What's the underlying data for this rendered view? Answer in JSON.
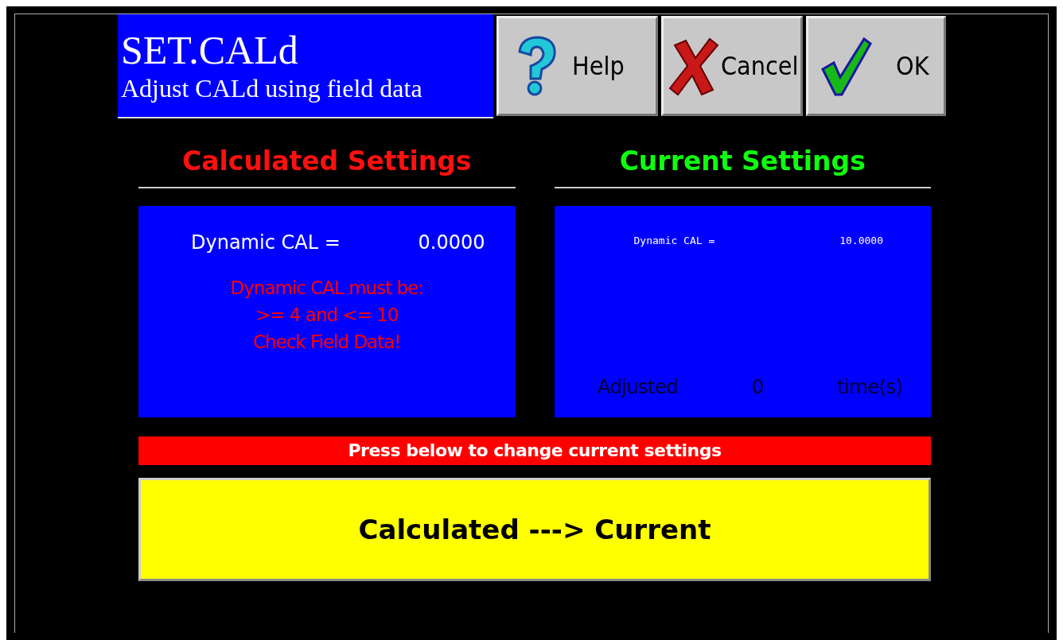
{
  "header": {
    "title": "SET.CALd",
    "subtitle": "Adjust CALd using field data"
  },
  "buttons": [
    {
      "kind": "help",
      "label": "Help"
    },
    {
      "kind": "cancel",
      "label": "Cancel"
    },
    {
      "kind": "ok",
      "label": "OK"
    }
  ],
  "calculated": {
    "heading": "Calculated Settings",
    "label": "Dynamic CAL =",
    "value": "0.0000",
    "warning": [
      "Dynamic CAL must be:",
      ">= 4 and <= 10",
      "Check Field Data!"
    ]
  },
  "current": {
    "heading": "Current Settings",
    "label": "Dynamic CAL =",
    "value": "10.0000",
    "adjusted_label": "Adjusted",
    "adjusted_count": "0",
    "adjusted_unit": "time(s)"
  },
  "banner": "Press below to change current settings",
  "transfer_button": "Calculated ---> Current"
}
